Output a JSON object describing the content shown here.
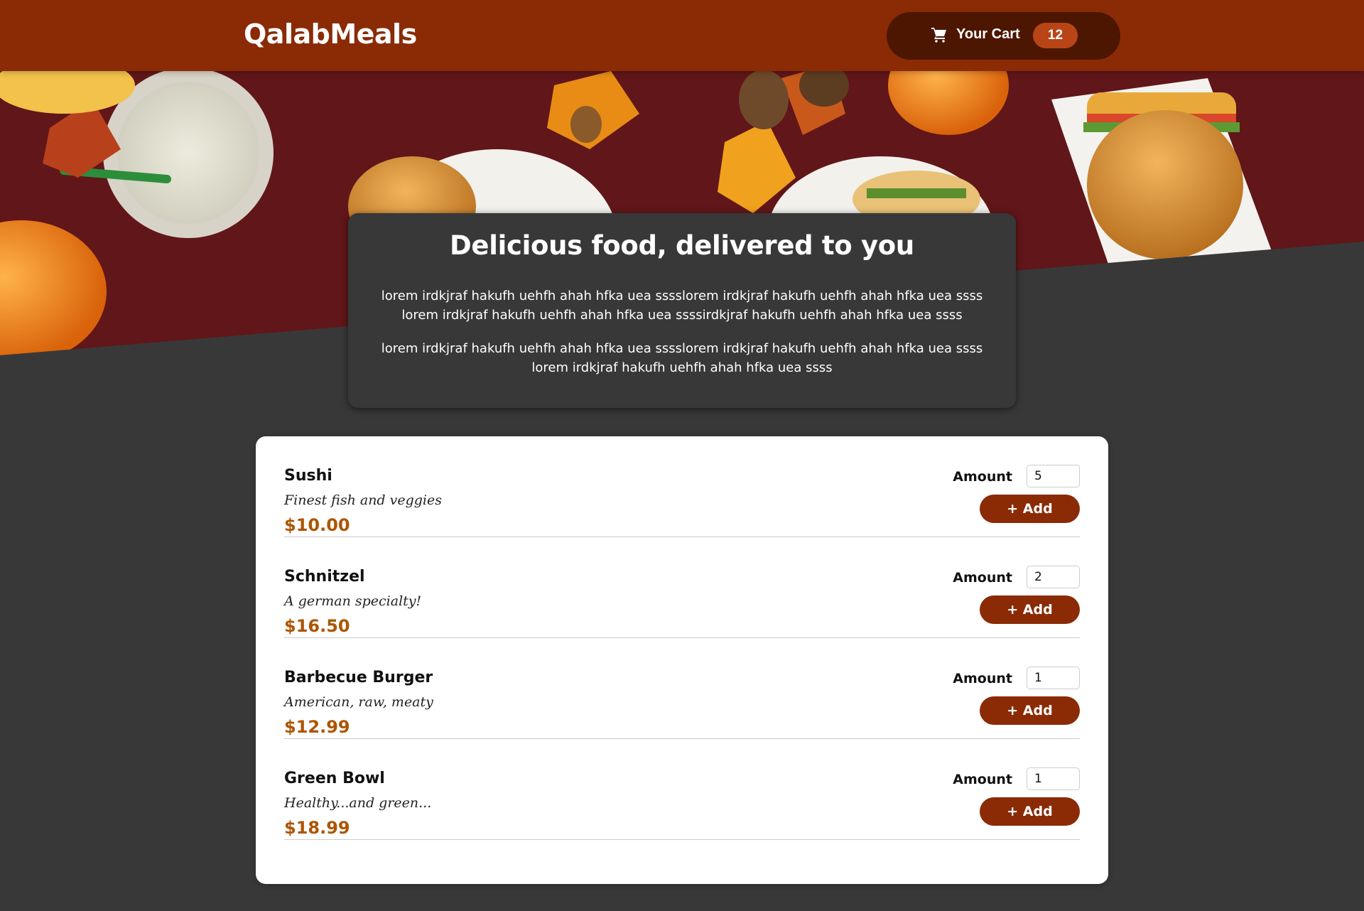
{
  "header": {
    "brand": "QalabMeals",
    "cart": {
      "label": "Your Cart",
      "badge": "12",
      "icon": "cart-icon"
    }
  },
  "summary": {
    "title": "Delicious food, delivered to you",
    "paragraphs": [
      "lorem irdkjraf hakufh uehfh ahah hfka uea sssslorem irdkjraf hakufh uehfh ahah hfka uea ssss lorem irdkjraf hakufh uehfh ahah hfka uea ssssirdkjraf hakufh uehfh ahah hfka uea ssss",
      "lorem irdkjraf hakufh uehfh ahah hfka uea sssslorem irdkjraf hakufh uehfh ahah hfka uea ssss lorem irdkjraf hakufh uehfh ahah hfka uea ssss"
    ]
  },
  "meals": [
    {
      "name": "Sushi",
      "description": "Finest fish and veggies",
      "price": "$10.00",
      "amount_label": "Amount",
      "amount": "5",
      "add_label": "+ Add"
    },
    {
      "name": "Schnitzel",
      "description": "A german specialty!",
      "price": "$16.50",
      "amount_label": "Amount",
      "amount": "2",
      "add_label": "+ Add"
    },
    {
      "name": "Barbecue Burger",
      "description": "American, raw, meaty",
      "price": "$12.99",
      "amount_label": "Amount",
      "amount": "1",
      "add_label": "+ Add"
    },
    {
      "name": "Green Bowl",
      "description": "Healthy...and green...",
      "price": "$18.99",
      "amount_label": "Amount",
      "amount": "1",
      "add_label": "+ Add"
    }
  ],
  "colors": {
    "header": "#8a2b06",
    "cart_button": "#4d1601",
    "badge": "#b94517",
    "price": "#ad5502",
    "background": "#383838"
  }
}
